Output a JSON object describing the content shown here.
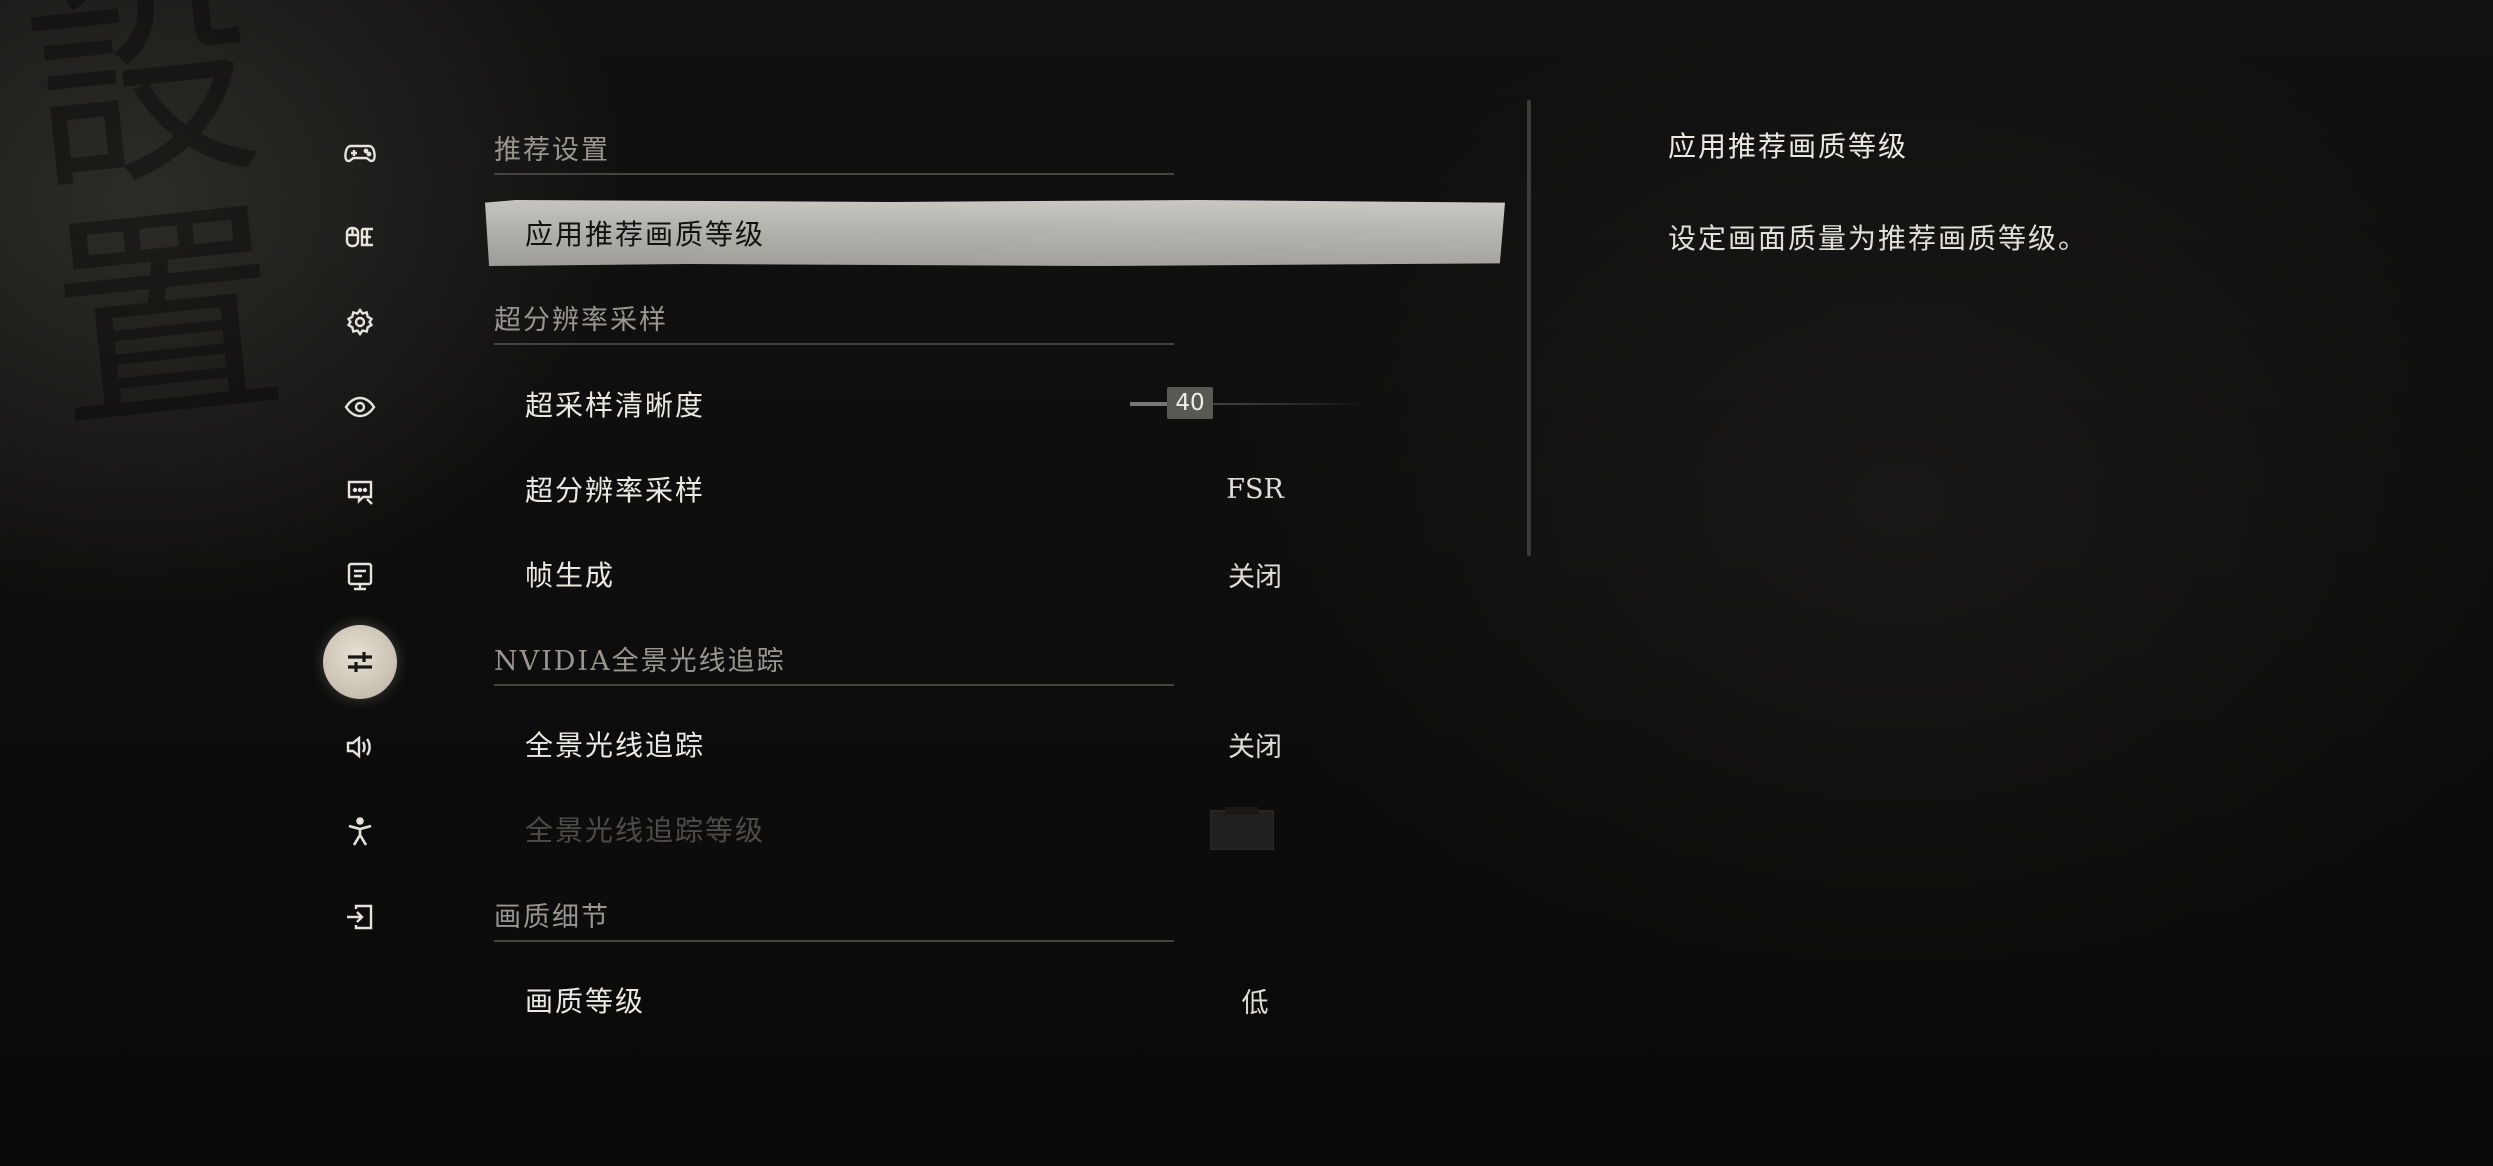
{
  "background": {
    "calligraphy": "設置"
  },
  "nav": {
    "items": [
      {
        "icon": "gamepad-icon",
        "active": false
      },
      {
        "icon": "keyboard-icon",
        "active": false
      },
      {
        "icon": "gear-icon",
        "active": false
      },
      {
        "icon": "eye-icon",
        "active": false
      },
      {
        "icon": "subtitle-icon",
        "active": false
      },
      {
        "icon": "monitor-icon",
        "active": false
      },
      {
        "icon": "sliders-icon",
        "active": true
      },
      {
        "icon": "speaker-icon",
        "active": false
      },
      {
        "icon": "accessibility-icon",
        "active": false
      },
      {
        "icon": "exit-icon",
        "active": false
      }
    ]
  },
  "sections": {
    "recommended": {
      "title": "推荐设置"
    },
    "super_resolution": {
      "title": "超分辨率采样"
    },
    "nvidia": {
      "title": "NVIDIA全景光线追踪"
    },
    "quality": {
      "title": "画质细节"
    }
  },
  "rows": {
    "apply_recommended": {
      "label": "应用推荐画质等级"
    },
    "super_sampling_sharpness": {
      "label": "超采样清晰度",
      "value": "40",
      "level_percent": 40
    },
    "super_resolution_mode": {
      "label": "超分辨率采样",
      "value": "FSR"
    },
    "frame_generation": {
      "label": "帧生成",
      "value": "关闭"
    },
    "full_ray_tracing": {
      "label": "全景光线追踪",
      "value": "关闭"
    },
    "full_ray_tracing_level": {
      "label": "全景光线追踪等级"
    },
    "quality_level": {
      "label": "画质等级",
      "value": "低"
    }
  },
  "description": {
    "title": "应用推荐画质等级",
    "text": "设定画面质量为推荐画质等级。"
  },
  "colors": {
    "selected_row": "#b8b6b1",
    "active_nav": "#d8d1c2",
    "text": "#ece9e2",
    "section_header": "#9a968f"
  }
}
